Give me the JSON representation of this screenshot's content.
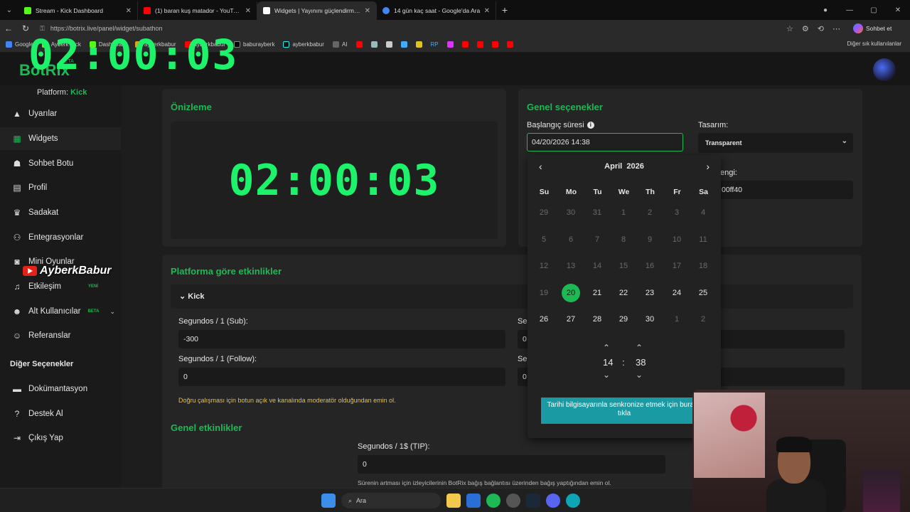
{
  "browser": {
    "tabs": [
      {
        "title": "Stream - Kick Dashboard",
        "color": "#53fc18"
      },
      {
        "title": "(1) baran kuş matador - YouTube",
        "color": "#ff0000"
      },
      {
        "title": "Widgets | Yayınını güçlendirmek i...",
        "color": "#ffffff"
      },
      {
        "title": "14 gün kaç saat - Google'da Ara",
        "color": "#4285f4"
      }
    ],
    "url": "https://botrix.live/panel/widget/subathon",
    "chat_label": "Sohbet et",
    "bookmarks": [
      "Google",
      "Ayberk Kick",
      "Dashboard",
      "ayberkbabur",
      "ayberkbabur",
      "baburayberk",
      "ayberkbabur",
      "AI",
      "RP"
    ],
    "other_bookmarks": "Diğer sık kullanılanlar"
  },
  "overlay": {
    "timer": "02:00:03"
  },
  "watermark": {
    "text": "AyberkBabur"
  },
  "app": {
    "brand": "BotRix",
    "brand_badge": "BETA",
    "platform_label": "Platform:",
    "platform_value": "Kick",
    "nav": [
      {
        "label": "Uyarılar",
        "icon": "warning-icon"
      },
      {
        "label": "Widgets",
        "icon": "grid-icon"
      },
      {
        "label": "Sohbet Botu",
        "icon": "robot-icon"
      },
      {
        "label": "Profil",
        "icon": "id-card-icon"
      },
      {
        "label": "Sadakat",
        "icon": "trophy-icon"
      },
      {
        "label": "Entegrasyonlar",
        "icon": "plug-icon"
      },
      {
        "label": "Mini Oyunlar",
        "icon": "gamepad-icon"
      },
      {
        "label": "Etkileşim",
        "icon": "music-icon",
        "badge": "YENİ"
      },
      {
        "label": "Alt Kullanıcılar",
        "icon": "users-icon",
        "badge": "BETA"
      },
      {
        "label": "Referanslar",
        "icon": "people-icon"
      }
    ],
    "other_section": "Diğer Seçenekler",
    "other_nav": [
      {
        "label": "Dokümantasyon",
        "icon": "book-icon"
      },
      {
        "label": "Destek Al",
        "icon": "help-icon"
      },
      {
        "label": "Çıkış Yap",
        "icon": "logout-icon"
      }
    ]
  },
  "preview": {
    "title": "Önizleme",
    "timer": "02:00:03"
  },
  "general": {
    "title": "Genel seçenekler",
    "start_label": "Başlangıç süresi",
    "start_value": "04/20/2026 14:38",
    "design_label": "Tasarım:",
    "design_value": "Transparent",
    "color_label": "engi:",
    "color_value": "00ff40"
  },
  "calendar": {
    "month": "April",
    "year": "2026",
    "weekdays": [
      "Su",
      "Mo",
      "Tu",
      "We",
      "Th",
      "Fr",
      "Sa"
    ],
    "weeks": [
      [
        {
          "d": "29",
          "dim": true
        },
        {
          "d": "30",
          "dim": true
        },
        {
          "d": "31",
          "dim": true
        },
        {
          "d": "1",
          "dim": true
        },
        {
          "d": "2",
          "dim": true
        },
        {
          "d": "3",
          "dim": true
        },
        {
          "d": "4",
          "dim": true
        }
      ],
      [
        {
          "d": "5",
          "dim": true
        },
        {
          "d": "6",
          "dim": true
        },
        {
          "d": "7",
          "dim": true
        },
        {
          "d": "8",
          "dim": true
        },
        {
          "d": "9",
          "dim": true
        },
        {
          "d": "10",
          "dim": true
        },
        {
          "d": "11",
          "dim": true
        }
      ],
      [
        {
          "d": "12",
          "dim": true
        },
        {
          "d": "13",
          "dim": true
        },
        {
          "d": "14",
          "dim": true
        },
        {
          "d": "15",
          "dim": true
        },
        {
          "d": "16",
          "dim": true
        },
        {
          "d": "17",
          "dim": true
        },
        {
          "d": "18",
          "dim": true
        }
      ],
      [
        {
          "d": "19",
          "dim": true
        },
        {
          "d": "20",
          "sel": true
        },
        {
          "d": "21"
        },
        {
          "d": "22"
        },
        {
          "d": "23"
        },
        {
          "d": "24"
        },
        {
          "d": "25"
        }
      ],
      [
        {
          "d": "26"
        },
        {
          "d": "27"
        },
        {
          "d": "28"
        },
        {
          "d": "29"
        },
        {
          "d": "30"
        },
        {
          "d": "1",
          "dim": true
        },
        {
          "d": "2",
          "dim": true
        }
      ]
    ],
    "hour": "14",
    "minute": "38",
    "separator": ":",
    "sync_button": "Tarihi bilgisayarınla senkronize etmek için buraya tıkla"
  },
  "platform_events": {
    "title": "Platforma göre etkinlikler",
    "kick_label": "Kick",
    "sub_label": "Segundos / 1 (Sub):",
    "sub_value": "-300",
    "follow_label": "Segundos / 1 (Follow):",
    "follow_value": "0",
    "right_label_1": "Seg",
    "right_value_1": "0",
    "right_label_2": "Seg",
    "right_value_2": "0",
    "warning": "Doğru çalışması için botun açık ve kanalında moderatör olduğundan emin ol."
  },
  "general_events": {
    "title": "Genel etkinlikler",
    "tip_label": "Segundos / 1$ (TIP):",
    "tip_value": "0",
    "note": "Sürenin artması için izleyicilerinin BotRix bağış bağlantısı üzerinden bağış yaptığından emin ol."
  },
  "taskbar": {
    "search": "Ara"
  }
}
